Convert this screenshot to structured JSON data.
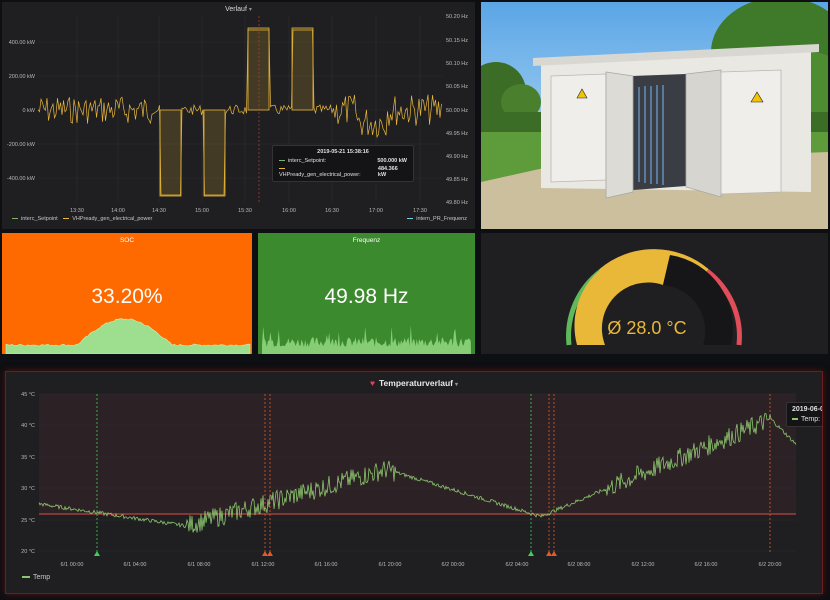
{
  "colors": {
    "background": "#0e0f12",
    "panel": "#1f1f22",
    "soc_panel": "#ff6a00",
    "freq_panel": "#3c8a2e",
    "sparkline": "#9ddf8f",
    "gauge_fill": "#eab839",
    "temp_line": "#8cc56f",
    "series_setpoint": "#7eb26d",
    "series_power": "#eab839",
    "alert_red": "#e24d42"
  },
  "verlauf": {
    "title": "Verlauf",
    "y_left_ticks": [
      "400.00 kW",
      "200.00 kW",
      "0 kW",
      "-200.00 kW",
      "-400.00 kW"
    ],
    "y_right_ticks": [
      "50.20 Hz",
      "50.15 Hz",
      "50.10 Hz",
      "50.05 Hz",
      "50.00 Hz",
      "49.95 Hz",
      "49.90 Hz",
      "49.85 Hz",
      "49.80 Hz"
    ],
    "x_ticks": [
      "13:30",
      "14:00",
      "14:30",
      "15:00",
      "15:30",
      "16:00",
      "16:30",
      "17:00",
      "17:30"
    ],
    "legend": [
      "interc_Setpoint",
      "VHPready_gen_electrical_power"
    ],
    "legend_right": "intern_PR_Frequenz",
    "tooltip": {
      "time": "2019-05-21 15:38:16",
      "rows": [
        {
          "label": "interc_Setpoint:",
          "value": "500.000 kW"
        },
        {
          "label": "VHPready_gen_electrical_power:",
          "value": "484.366 kW"
        }
      ]
    }
  },
  "photo": {
    "icon": "battery-container-photo-icon"
  },
  "soc": {
    "title": "SOC",
    "value": "33.20%"
  },
  "frequenz": {
    "title": "Frequenz",
    "value": "49.98 Hz"
  },
  "gauge": {
    "value_text": "Ø 28.0 °C",
    "value": 28.0
  },
  "temperatur": {
    "title": "Temperaturverlauf",
    "y_ticks": [
      "45 °C",
      "40 °C",
      "35 °C",
      "30 °C",
      "25 °C",
      "20 °C"
    ],
    "x_ticks": [
      "6/1 00:00",
      "6/1 04:00",
      "6/1 08:00",
      "6/1 12:00",
      "6/1 16:00",
      "6/1 20:00",
      "6/2 00:00",
      "6/2 04:00",
      "6/2 08:00",
      "6/2 12:00",
      "6/2 16:00",
      "6/2 20:00"
    ],
    "legend": "Temp",
    "tooltip_time": "2019-06-0",
    "tooltip_label": "Temp:"
  }
}
